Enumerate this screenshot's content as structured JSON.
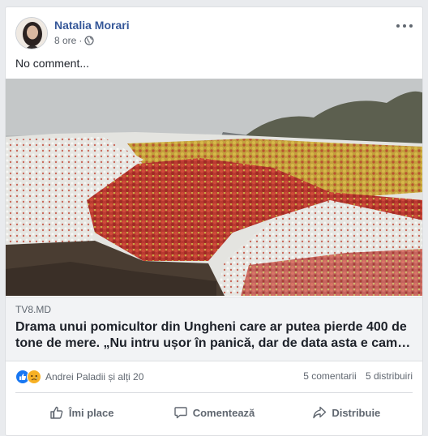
{
  "post": {
    "author": "Natalia Morari",
    "time": "8 ore",
    "separator": "·",
    "audience_icon": "globe-icon",
    "text": "No comment..."
  },
  "link": {
    "domain": "TV8.MD",
    "title": "Drama unui pomicultor din Ungheni care ar putea pierde 400 de tone de mere. „Nu intru ușor în panică, dar de data asta e cam…"
  },
  "stats": {
    "reactions": [
      "like-icon",
      "sad-icon"
    ],
    "reacted_by": "Andrei Paladii și alți 20",
    "comments": "5 comentarii",
    "shares": "5 distribuiri"
  },
  "actions": {
    "like": "Îmi place",
    "comment": "Comentează",
    "share": "Distribuie"
  },
  "colors": {
    "author": "#365899",
    "like_blue": "#1877f2",
    "background": "#e9ebee"
  }
}
